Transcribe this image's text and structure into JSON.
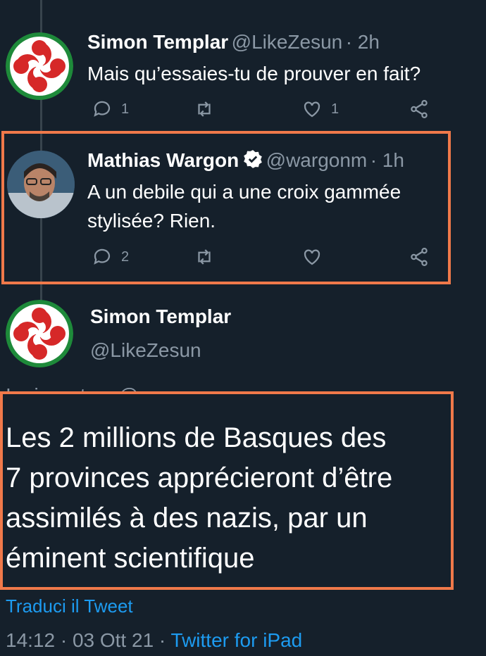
{
  "tweet1": {
    "name": "Simon Templar",
    "handle": "@LikeZesun",
    "time": "· 2h",
    "text": "Mais qu’essaies-tu de prouver en fait?",
    "reply_count": "1",
    "like_count": "1",
    "avatar_icon": "lauburu-icon"
  },
  "tweet2": {
    "name": "Mathias Wargon",
    "handle": "@wargonm",
    "time": "· 1h",
    "text_line1": "A un debile qui a une croix gammée",
    "text_line2": "stylisée? Rien.",
    "reply_count": "2",
    "verified_icon": "verified-badge-icon"
  },
  "main_tweet": {
    "name": "Simon Templar",
    "handle": "@LikeZesun",
    "reply_to": "In risposta a @wargonm",
    "text_line1": "Les 2 millions de Basques des",
    "text_line2": "7 provinces apprécieront d’être",
    "text_line3": "assimilés à des nazis, par un",
    "text_line4": "éminent scientifique",
    "translate": "Traduci il Tweet",
    "timestamp": "14:12 · 03 Ott 21 · ",
    "source": "Twitter for iPad"
  },
  "colors": {
    "background": "#15202b",
    "accent": "#1d9bf0",
    "highlight_box": "#f0794a",
    "muted": "#8b98a5"
  }
}
